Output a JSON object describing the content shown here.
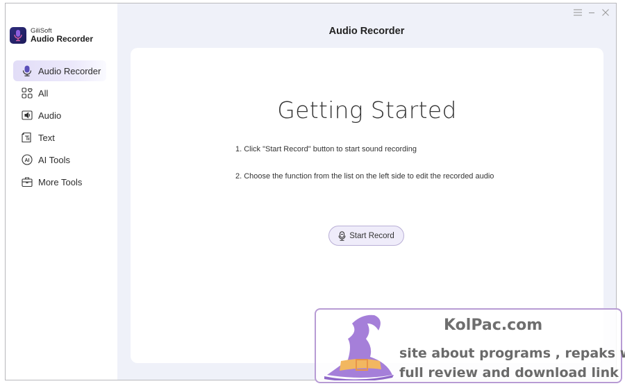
{
  "window": {
    "title": "Audio Recorder",
    "controls": {
      "menu_icon": "hamburger-menu-icon",
      "minimize_icon": "minimize-icon",
      "close_icon": "close-icon"
    }
  },
  "brand": {
    "company": "GiliSoft",
    "product": "Audio Recorder",
    "logo_icon": "microphone-logo-icon"
  },
  "sidebar": {
    "items": [
      {
        "label": "Audio Recorder",
        "icon": "microphone-icon",
        "active": true
      },
      {
        "label": "All",
        "icon": "grid-heart-icon",
        "active": false
      },
      {
        "label": "Audio",
        "icon": "audio-file-icon",
        "active": false
      },
      {
        "label": "Text",
        "icon": "text-file-icon",
        "active": false
      },
      {
        "label": "AI Tools",
        "icon": "ai-circle-icon",
        "active": false
      },
      {
        "label": "More Tools",
        "icon": "toolbox-icon",
        "active": false
      }
    ]
  },
  "main": {
    "heading": "Getting Started",
    "steps": [
      "1. Click \"Start Record\" button to start sound recording",
      "2. Choose the function from the list on the left side to edit the recorded audio"
    ],
    "start_button": {
      "label": "Start Record",
      "icon": "microphone-icon"
    }
  },
  "watermark": {
    "site": "KolPac.com",
    "line1": "site about programs , repaks with",
    "line2": "full review and download link",
    "icon": "wizard-hat-icon"
  },
  "colors": {
    "accent": "#7c6fd6",
    "active_bg": "#e2ddf7",
    "button_bg": "#efecfa",
    "button_border": "#b9afd6",
    "app_bg": "#eff1f9",
    "watermark_border": "#b79bd4"
  }
}
